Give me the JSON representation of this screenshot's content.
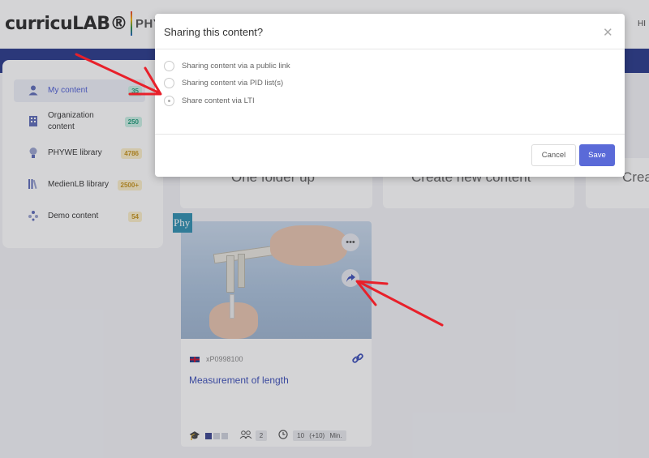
{
  "app": {
    "logo_text": "curricuLAB®",
    "logo_brand": "PHYWE",
    "header_right": "HI"
  },
  "sidebar": {
    "items": [
      {
        "label": "My content",
        "badge": "35",
        "icon": "user-icon"
      },
      {
        "label": "Organization content",
        "badge": "250",
        "icon": "building-icon"
      },
      {
        "label": "PHYWE library",
        "badge": "4786",
        "icon": "lightbulb-icon"
      },
      {
        "label": "MedienLB library",
        "badge": "2500+",
        "icon": "books-icon"
      },
      {
        "label": "Demo content",
        "badge": "54",
        "icon": "demo-icon"
      }
    ]
  },
  "tiles": [
    {
      "label": "One folder up"
    },
    {
      "label": "Create new content"
    },
    {
      "label": "Crea"
    }
  ],
  "card": {
    "tag": "Phy",
    "code": "xP0998100",
    "title": "Measurement of length",
    "level_filled": 1,
    "level_total": 4,
    "group_size": "2",
    "time_main": "10",
    "time_extra": "(+10)",
    "time_unit": "Min."
  },
  "modal": {
    "title": "Sharing this content?",
    "options": [
      {
        "label": "Sharing content via a public link",
        "selected": false
      },
      {
        "label": "Sharing content via PID list(s)",
        "selected": false
      },
      {
        "label": "Share content via LTI",
        "selected": true
      }
    ],
    "cancel_label": "Cancel",
    "save_label": "Save"
  },
  "colors": {
    "accent": "#5a6ad8",
    "header_band": "#27388a",
    "annotation_arrow": "#e8202a"
  }
}
